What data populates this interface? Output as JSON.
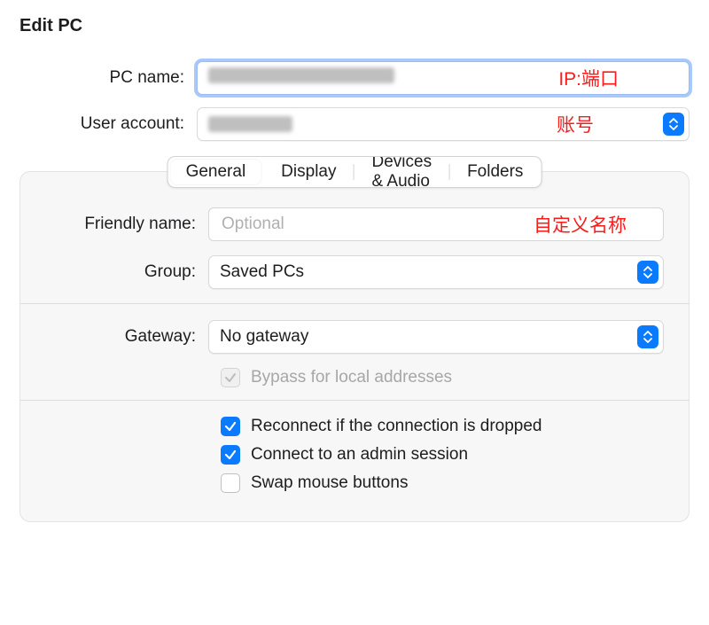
{
  "title": "Edit PC",
  "top": {
    "pc_name_label": "PC name:",
    "pc_name_annotation": "IP:端口",
    "user_account_label": "User account:",
    "user_account_annotation": "账号"
  },
  "tabs": {
    "general": "General",
    "display": "Display",
    "devices": "Devices & Audio",
    "folders": "Folders"
  },
  "general": {
    "friendly_name_label": "Friendly name:",
    "friendly_name_placeholder": "Optional",
    "friendly_name_annotation": "自定义名称",
    "group_label": "Group:",
    "group_value": "Saved PCs",
    "gateway_label": "Gateway:",
    "gateway_value": "No gateway",
    "bypass_label": "Bypass for local addresses",
    "reconnect_label": "Reconnect if the connection is dropped",
    "admin_label": "Connect to an admin session",
    "swap_label": "Swap mouse buttons"
  },
  "colors": {
    "accent": "#0a7aff",
    "annotation": "#ff1a1a"
  }
}
